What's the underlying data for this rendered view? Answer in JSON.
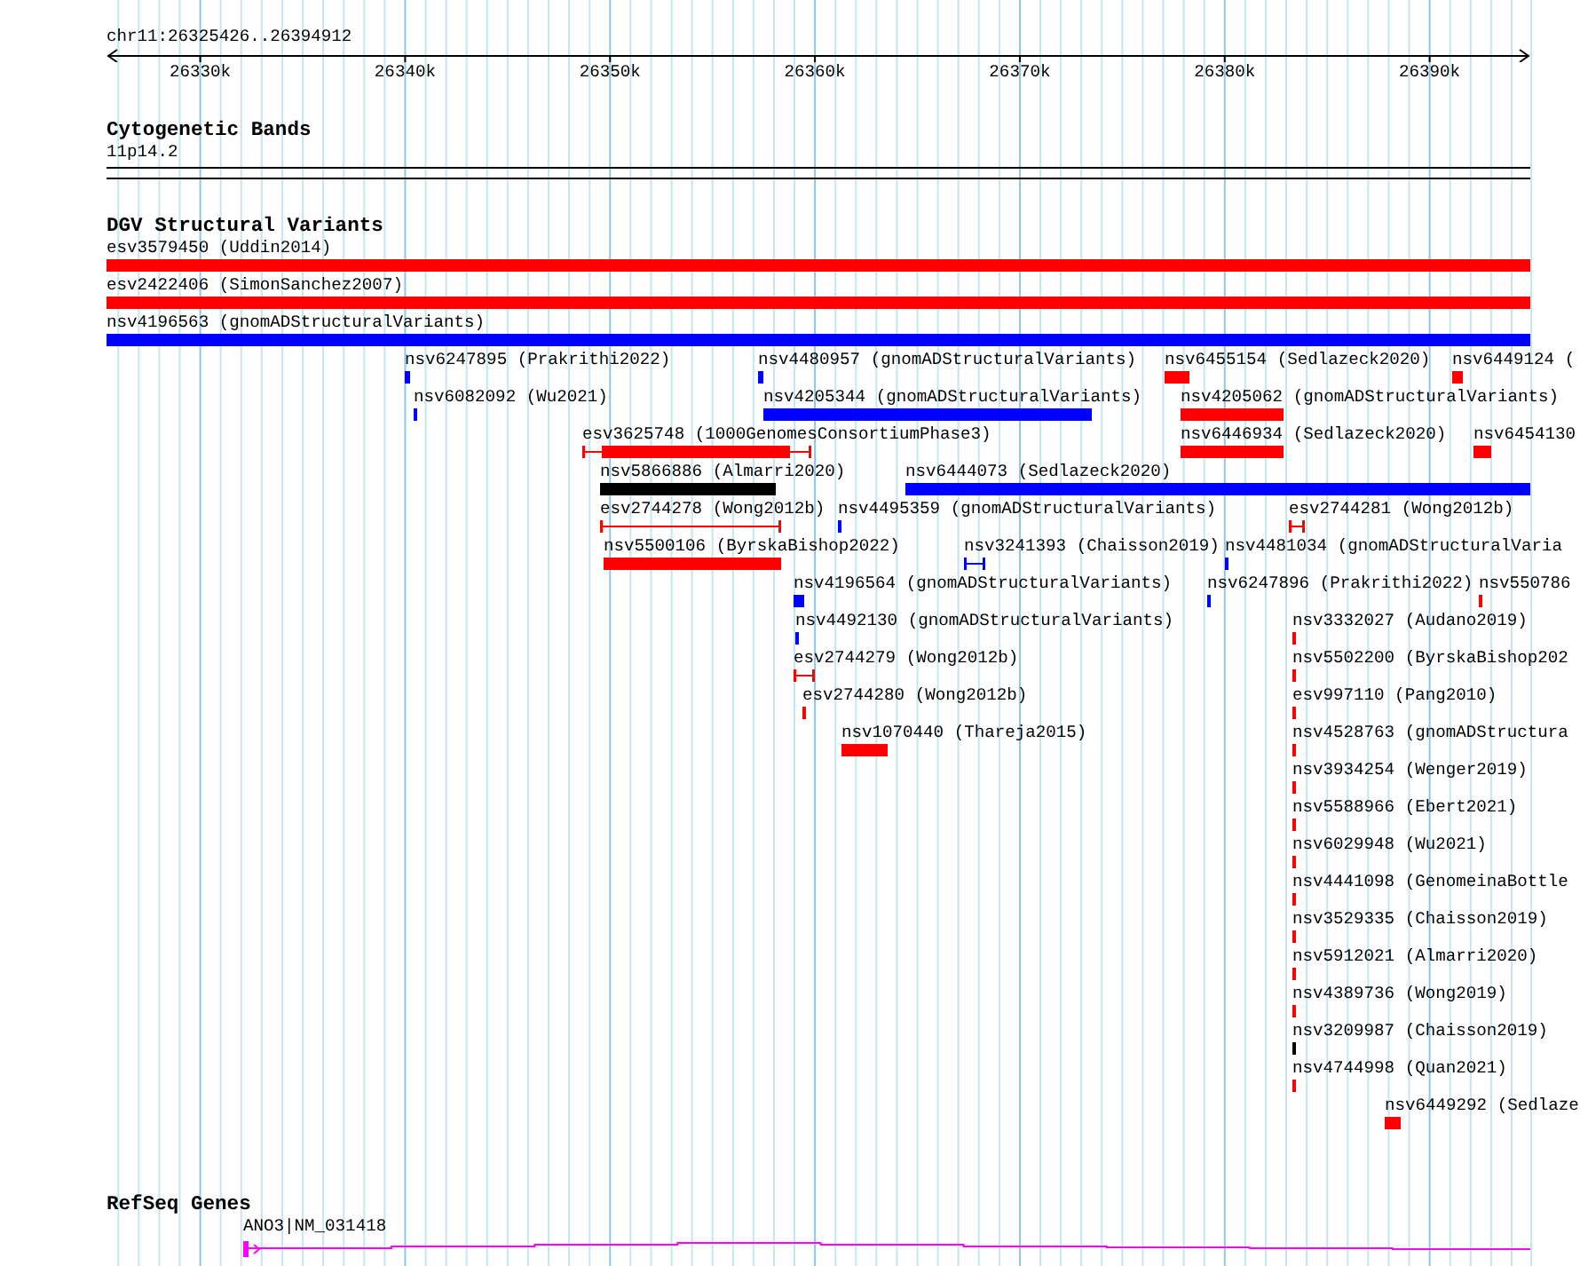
{
  "ruler": {
    "location": "chr11:26325426..26394912",
    "ticks": [
      {
        "label": "26330k"
      },
      {
        "label": "26340k"
      },
      {
        "label": "26350k"
      },
      {
        "label": "26360k"
      },
      {
        "label": "26370k"
      },
      {
        "label": "26380k"
      },
      {
        "label": "26390k"
      }
    ]
  },
  "tracks": [
    {
      "kind": "cytoband",
      "title": "Cytogenetic Bands",
      "band": "11p14.2"
    },
    {
      "kind": "variants",
      "title": "DGV Structural Variants",
      "lanes": [
        {
          "features": [
            {
              "kind": "bar",
              "label": "esv3579450 (Uddin2014)",
              "color": "#ff0000"
            }
          ]
        },
        {
          "features": [
            {
              "kind": "bar",
              "label": "esv2422406 (SimonSanchez2007)",
              "color": "#ff0000"
            }
          ]
        },
        {
          "features": [
            {
              "kind": "bar",
              "label": "nsv4196563 (gnomADStructuralVariants)",
              "color": "#0000ff"
            }
          ]
        },
        {
          "features": [
            {
              "kind": "bar",
              "label": "nsv6247895 (Prakrithi2022)",
              "color": "#0000ff"
            },
            {
              "kind": "bar",
              "label": "nsv4480957 (gnomADStructuralVariants)",
              "color": "#0000ff"
            },
            {
              "kind": "bar",
              "label": "nsv6455154 (Sedlazeck2020)",
              "color": "#ff0000"
            },
            {
              "kind": "bar",
              "label": "nsv6449124 (",
              "color": "#ff0000"
            }
          ]
        },
        {
          "features": [
            {
              "kind": "bar",
              "label": "nsv6082092 (Wu2021)",
              "color": "#0000ff"
            },
            {
              "kind": "bar",
              "label": "nsv4205344 (gnomADStructuralVariants)",
              "color": "#0000ff"
            },
            {
              "kind": "bar",
              "label": "nsv4205062 (gnomADStructuralVariants)",
              "color": "#ff0000"
            }
          ]
        },
        {
          "features": [
            {
              "kind": "capped",
              "label": "esv3625748 (1000GenomesConsortiumPhase3)",
              "color": "#ff0000"
            },
            {
              "kind": "bar",
              "label": "nsv6446934 (Sedlazeck2020)",
              "color": "#ff0000"
            },
            {
              "kind": "bar",
              "label": "nsv6454130",
              "color": "#ff0000"
            }
          ]
        },
        {
          "features": [
            {
              "kind": "bar",
              "label": "nsv5866886 (Almarri2020)",
              "color": "#000000"
            },
            {
              "kind": "bar",
              "label": "nsv6444073 (Sedlazeck2020)",
              "color": "#0000ff"
            }
          ]
        },
        {
          "features": [
            {
              "kind": "capped",
              "label": "esv2744278 (Wong2012b)",
              "color": "#ff0000"
            },
            {
              "kind": "bar",
              "label": "nsv4495359 (gnomADStructuralVariants)",
              "color": "#0000ff"
            },
            {
              "kind": "capped",
              "label": "esv2744281 (Wong2012b)",
              "color": "#ff0000"
            }
          ]
        },
        {
          "features": [
            {
              "kind": "bar",
              "label": "nsv5500106 (ByrskaBishop2022)",
              "color": "#ff0000"
            },
            {
              "kind": "capped",
              "label": "nsv3241393 (Chaisson2019)",
              "color": "#0000ff"
            },
            {
              "kind": "bar",
              "label": "nsv4481034 (gnomADStructuralVaria",
              "color": "#0000ff"
            }
          ]
        },
        {
          "features": [
            {
              "kind": "bar",
              "label": "nsv4196564 (gnomADStructuralVariants)",
              "color": "#0000ff"
            },
            {
              "kind": "bar",
              "label": "nsv6247896 (Prakrithi2022)",
              "color": "#0000ff"
            },
            {
              "kind": "bar",
              "label": "nsv550786",
              "color": "#ff0000"
            }
          ]
        },
        {
          "features": [
            {
              "kind": "bar",
              "label": "nsv4492130 (gnomADStructuralVariants)",
              "color": "#0000ff"
            },
            {
              "kind": "bar",
              "label": "nsv3332027 (Audano2019)",
              "color": "#ff0000"
            }
          ]
        },
        {
          "features": [
            {
              "kind": "capped",
              "label": "esv2744279 (Wong2012b)",
              "color": "#ff0000"
            },
            {
              "kind": "bar",
              "label": "nsv5502200 (ByrskaBishop202",
              "color": "#ff0000"
            }
          ]
        },
        {
          "features": [
            {
              "kind": "bar",
              "label": "esv2744280 (Wong2012b)",
              "color": "#ff0000"
            },
            {
              "kind": "bar",
              "label": "esv997110 (Pang2010)",
              "color": "#ff0000"
            }
          ]
        },
        {
          "features": [
            {
              "kind": "bar",
              "label": "nsv1070440 (Thareja2015)",
              "color": "#ff0000"
            },
            {
              "kind": "bar",
              "label": "nsv4528763 (gnomADStructura",
              "color": "#ff0000"
            }
          ]
        },
        {
          "features": [
            {
              "kind": "bar",
              "label": "nsv3934254 (Wenger2019)",
              "color": "#ff0000"
            }
          ]
        },
        {
          "features": [
            {
              "kind": "bar",
              "label": "nsv5588966 (Ebert2021)",
              "color": "#ff0000"
            }
          ]
        },
        {
          "features": [
            {
              "kind": "bar",
              "label": "nsv6029948 (Wu2021)",
              "color": "#ff0000"
            }
          ]
        },
        {
          "features": [
            {
              "kind": "bar",
              "label": "nsv4441098 (GenomeinaBottle",
              "color": "#ff0000"
            }
          ]
        },
        {
          "features": [
            {
              "kind": "bar",
              "label": "nsv3529335 (Chaisson2019)",
              "color": "#ff0000"
            }
          ]
        },
        {
          "features": [
            {
              "kind": "bar",
              "label": "nsv5912021 (Almarri2020)",
              "color": "#ff0000"
            }
          ]
        },
        {
          "features": [
            {
              "kind": "bar",
              "label": "nsv4389736 (Wong2019)",
              "color": "#ff0000"
            }
          ]
        },
        {
          "features": [
            {
              "kind": "bar",
              "label": "nsv3209987 (Chaisson2019)",
              "color": "#000000"
            }
          ]
        },
        {
          "features": [
            {
              "kind": "bar",
              "label": "nsv4744998 (Quan2021)",
              "color": "#ff0000"
            }
          ]
        },
        {
          "features": [
            {
              "kind": "bar",
              "label": "nsv6449292 (Sedlaze",
              "color": "#ff0000"
            }
          ]
        }
      ]
    },
    {
      "kind": "genes",
      "title": "RefSeq Genes",
      "gene": {
        "label": "ANO3|NM_031418"
      }
    }
  ]
}
